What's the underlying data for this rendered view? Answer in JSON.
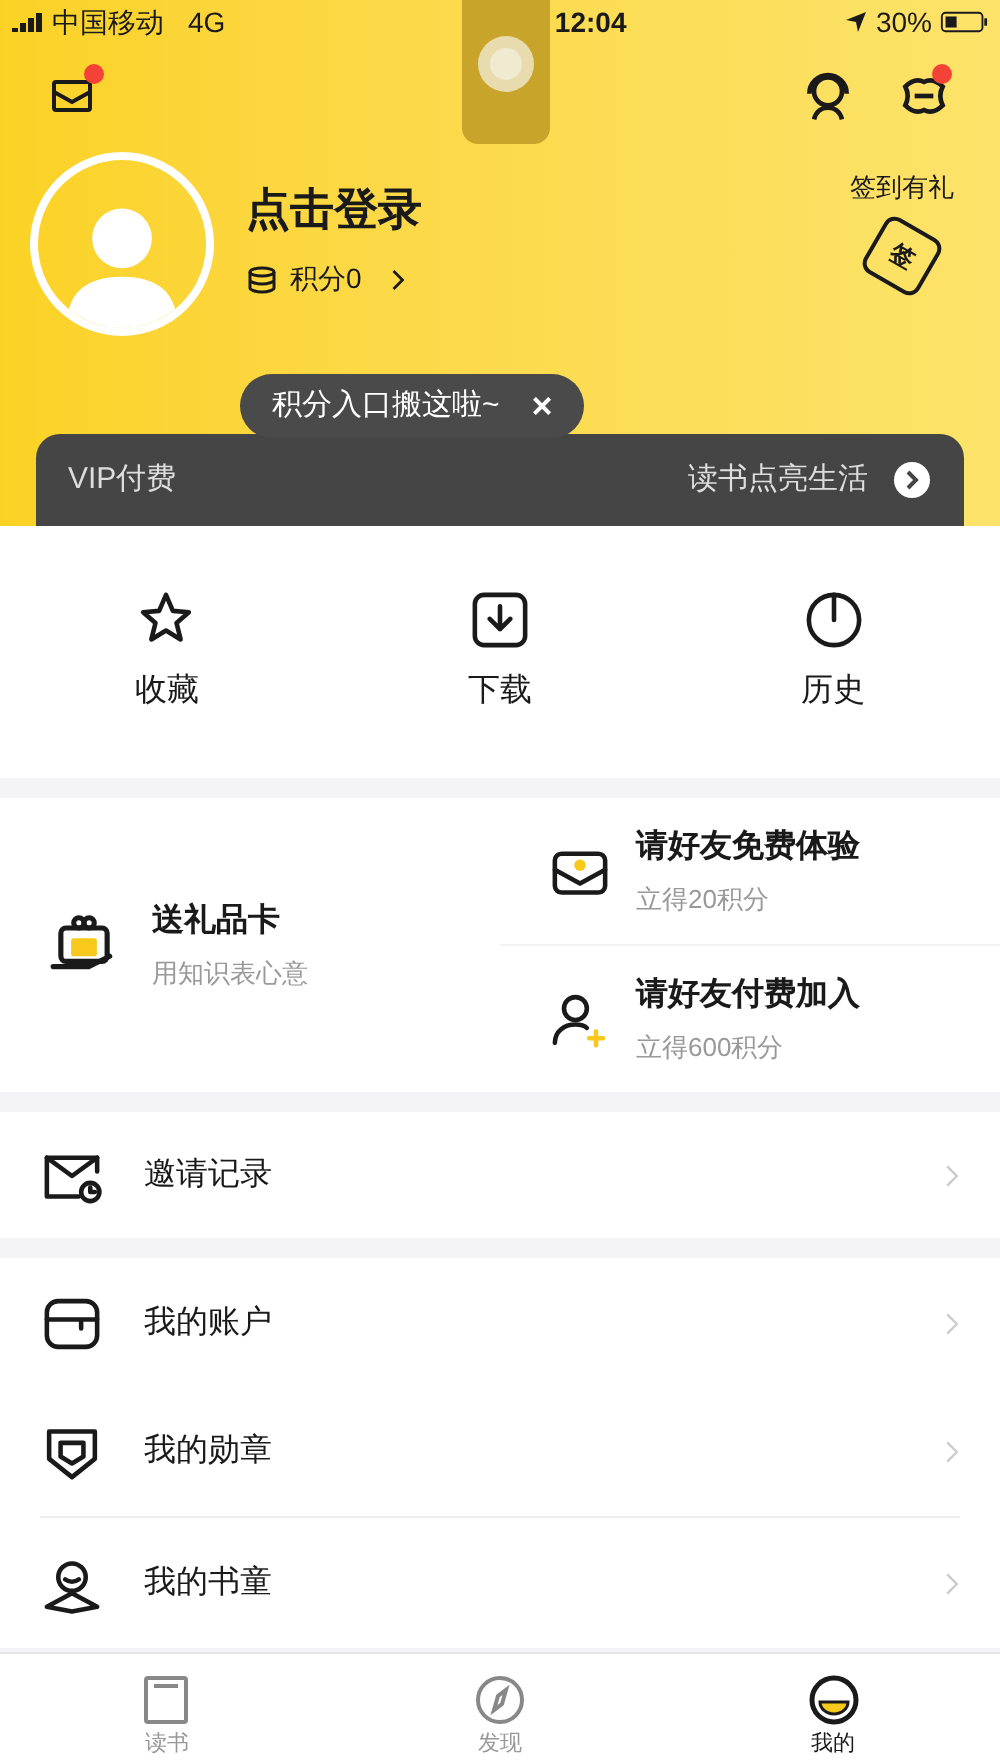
{
  "status_bar": {
    "carrier": "中国移动",
    "network": "4G",
    "time": "12:04",
    "battery": "30%"
  },
  "header": {
    "mail_badge": true,
    "settings_badge": true,
    "login": "点击登录",
    "points": "积分0",
    "checkin": "签到有礼",
    "checkin_icon_text": "签"
  },
  "tooltip": {
    "text": "积分入口搬这啦~",
    "close": "×"
  },
  "vip_bar": {
    "label": "VIP付费",
    "slogan": "读书点亮生活"
  },
  "quick_actions": [
    {
      "kind": "star",
      "label": "收藏"
    },
    {
      "kind": "download",
      "label": "下载"
    },
    {
      "kind": "history",
      "label": "历史"
    }
  ],
  "gift_card": {
    "title": "送礼品卡",
    "subtitle": "用知识表心意"
  },
  "invites": [
    {
      "kind": "envelope",
      "title": "请好友免费体验",
      "subtitle": "立得20积分"
    },
    {
      "kind": "user",
      "title": "请好友付费加入",
      "subtitle": "立得600积分"
    }
  ],
  "menu_groups": [
    [
      {
        "kind": "record",
        "label": "邀请记录"
      }
    ],
    [
      {
        "kind": "account",
        "label": "我的账户"
      },
      {
        "kind": "badge",
        "label": "我的勋章"
      },
      {
        "kind": "buddy",
        "label": "我的书童"
      }
    ]
  ],
  "tab_bar": [
    {
      "kind": "book",
      "label": "读书",
      "selected": false
    },
    {
      "kind": "compass",
      "label": "发现",
      "selected": false
    },
    {
      "kind": "me",
      "label": "我的",
      "selected": true
    }
  ]
}
